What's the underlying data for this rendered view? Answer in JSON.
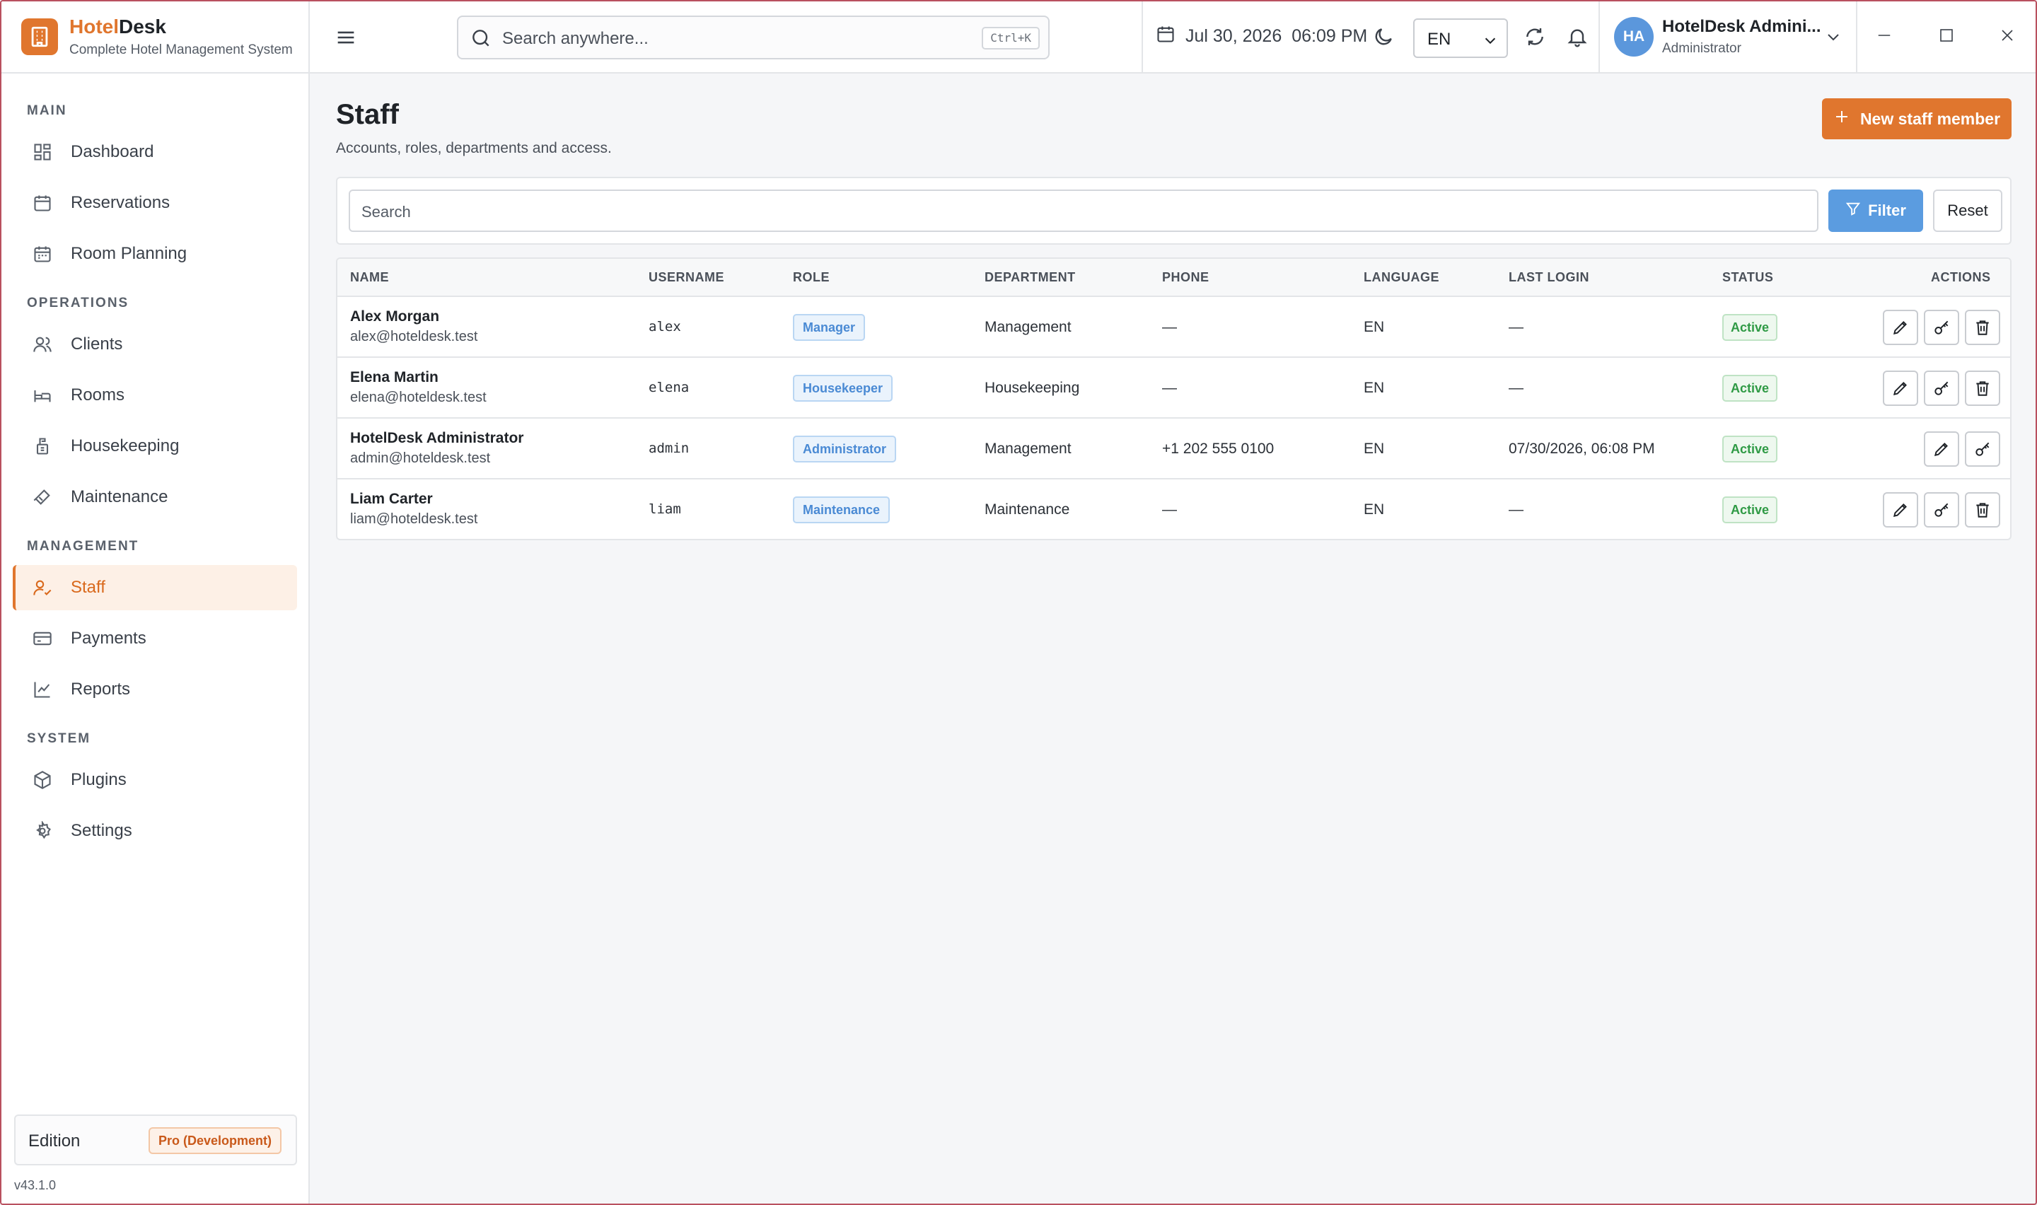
{
  "brand": {
    "name_a": "Hotel",
    "name_b": "Desk",
    "subtitle": "Complete Hotel Management System"
  },
  "sidebar": {
    "sections": [
      "MAIN",
      "OPERATIONS",
      "MANAGEMENT",
      "SYSTEM"
    ],
    "items": [
      {
        "label": "Dashboard",
        "icon": "dashboard-icon"
      },
      {
        "label": "Reservations",
        "icon": "calendar-icon"
      },
      {
        "label": "Room Planning",
        "icon": "calendar-grid-icon"
      },
      {
        "label": "Clients",
        "icon": "users-icon"
      },
      {
        "label": "Rooms",
        "icon": "bed-icon"
      },
      {
        "label": "Housekeeping",
        "icon": "housekeeping-icon"
      },
      {
        "label": "Maintenance",
        "icon": "wrench-icon"
      },
      {
        "label": "Staff",
        "icon": "staff-icon",
        "active": true
      },
      {
        "label": "Payments",
        "icon": "credit-card-icon"
      },
      {
        "label": "Reports",
        "icon": "chart-icon"
      },
      {
        "label": "Plugins",
        "icon": "cube-icon"
      },
      {
        "label": "Settings",
        "icon": "gear-icon"
      }
    ],
    "edition_label": "Edition",
    "edition_value": "Pro (Development)",
    "version": "v43.1.0"
  },
  "topbar": {
    "search_placeholder": "Search anywhere...",
    "shortcut": "Ctrl+K",
    "date": "Jul 30, 2026",
    "time": "06:09 PM",
    "language": "EN",
    "user_initials": "HA",
    "user_name": "HotelDesk Admini...",
    "user_role": "Administrator"
  },
  "page": {
    "title": "Staff",
    "subtitle": "Accounts, roles, departments and access.",
    "new_button": "New staff member"
  },
  "filters": {
    "search_placeholder": "Search",
    "filter_label": "Filter",
    "reset_label": "Reset"
  },
  "table": {
    "columns": [
      "NAME",
      "USERNAME",
      "ROLE",
      "DEPARTMENT",
      "PHONE",
      "LANGUAGE",
      "LAST LOGIN",
      "STATUS",
      "ACTIONS"
    ],
    "rows": [
      {
        "name": "Alex Morgan",
        "email": "alex@hoteldesk.test",
        "username": "alex",
        "role": "Manager",
        "department": "Management",
        "phone": "—",
        "language": "EN",
        "last_login": "—",
        "status": "Active"
      },
      {
        "name": "Elena Martin",
        "email": "elena@hoteldesk.test",
        "username": "elena",
        "role": "Housekeeper",
        "department": "Housekeeping",
        "phone": "—",
        "language": "EN",
        "last_login": "—",
        "status": "Active"
      },
      {
        "name": "HotelDesk Administrator",
        "email": "admin@hoteldesk.test",
        "username": "admin",
        "role": "Administrator",
        "department": "Management",
        "phone": "+1 202 555 0100",
        "language": "EN",
        "last_login": "07/30/2026, 06:08 PM",
        "status": "Active"
      },
      {
        "name": "Liam Carter",
        "email": "liam@hoteldesk.test",
        "username": "liam",
        "role": "Maintenance",
        "department": "Maintenance",
        "phone": "—",
        "language": "EN",
        "last_login": "—",
        "status": "Active"
      }
    ]
  },
  "colors": {
    "accent": "#e0762e",
    "primary_blue": "#5b9ce0",
    "success": "#2f9a45",
    "window_border": "#b9505f"
  }
}
